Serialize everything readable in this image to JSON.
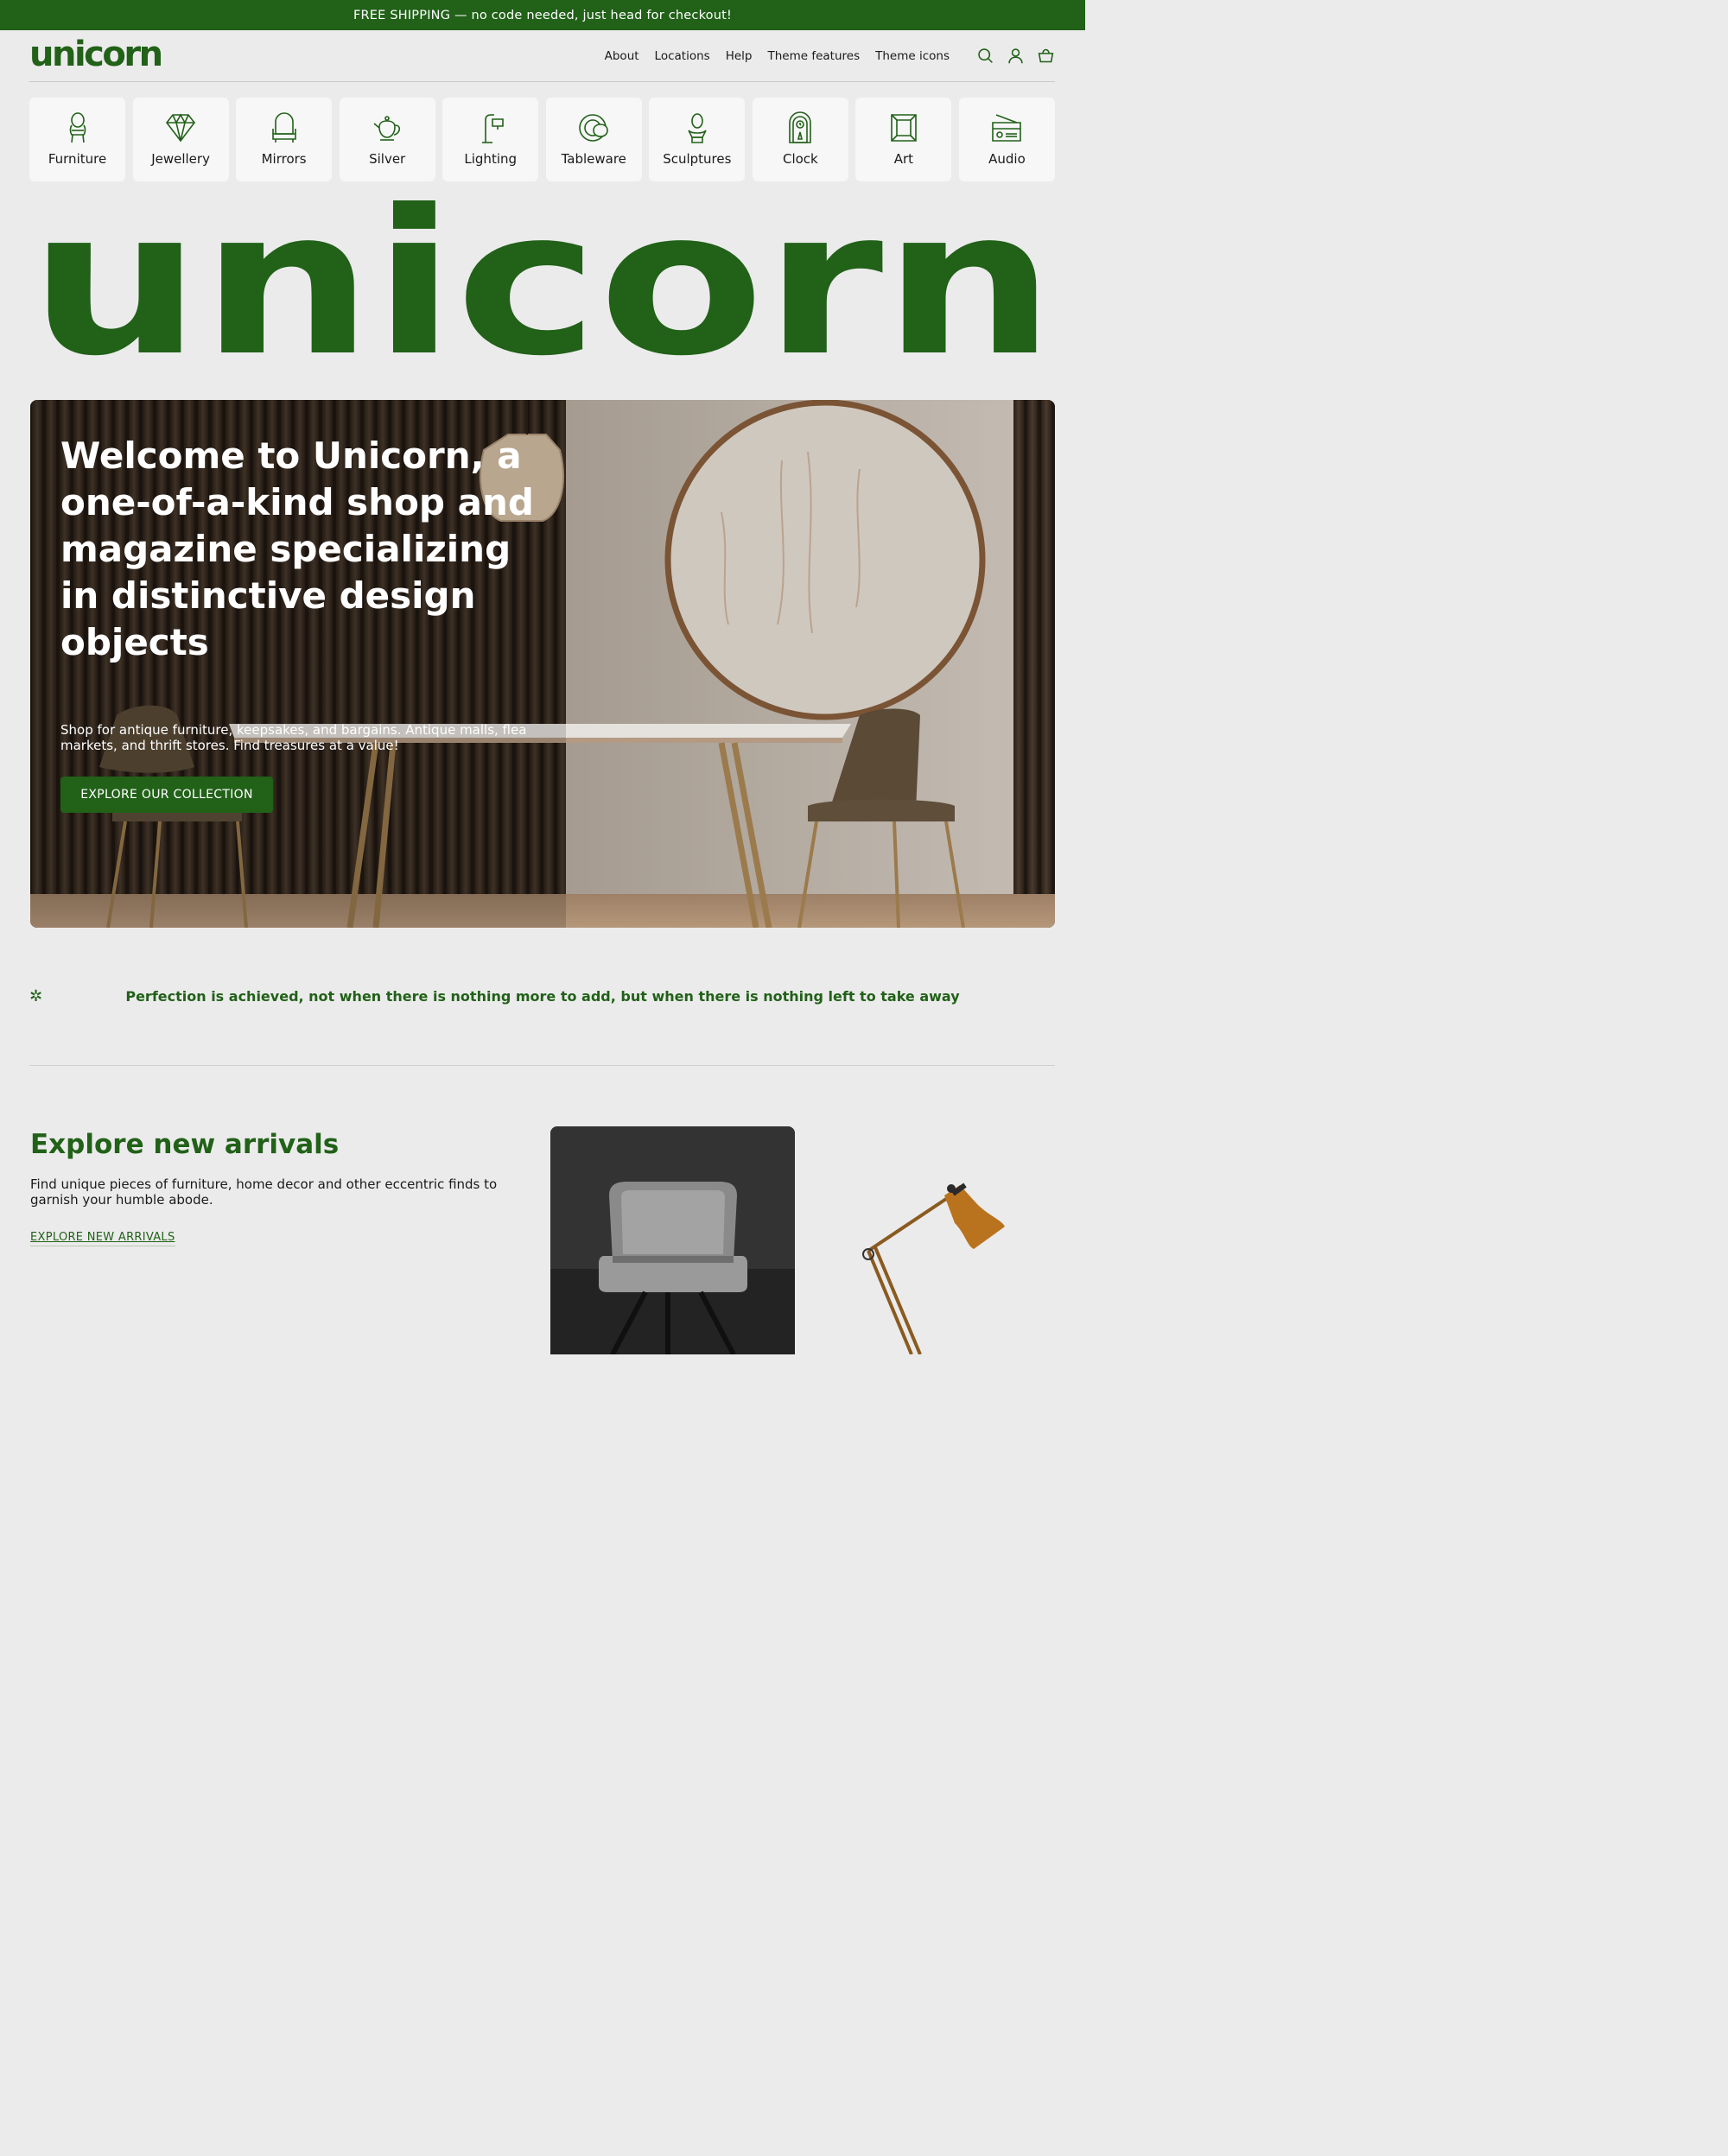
{
  "announcement": "FREE SHIPPING — no code needed, just head for checkout!",
  "header": {
    "logo": "unicorn",
    "nav": [
      "About",
      "Locations",
      "Help",
      "Theme features",
      "Theme icons"
    ],
    "icons": [
      "search-icon",
      "account-icon",
      "cart-icon"
    ]
  },
  "categories": [
    {
      "label": "Furniture",
      "icon": "chair-icon"
    },
    {
      "label": "Jewellery",
      "icon": "diamond-icon"
    },
    {
      "label": "Mirrors",
      "icon": "mirror-icon"
    },
    {
      "label": "Silver",
      "icon": "teapot-icon"
    },
    {
      "label": "Lighting",
      "icon": "lamp-icon"
    },
    {
      "label": "Tableware",
      "icon": "plate-icon"
    },
    {
      "label": "Sculptures",
      "icon": "bust-icon"
    },
    {
      "label": "Clock",
      "icon": "clock-icon"
    },
    {
      "label": "Art",
      "icon": "frame-icon"
    },
    {
      "label": "Audio",
      "icon": "radio-icon"
    }
  ],
  "big_wordmark": "unicorn",
  "hero": {
    "title": "Welcome to Unicorn, a one-of-a-kind shop and magazine specializing in distinctive design objects",
    "subtitle": "Shop for antique furniture, keepsakes, and bargains. Antique malls, flea markets, and thrift stores. Find treasures at a value!",
    "button": "EXPLORE OUR COLLECTION"
  },
  "quote": {
    "icon": "asterisk-icon",
    "text": "Perfection is achieved, not when there is nothing more to add, but when there is nothing left to take away"
  },
  "arrivals": {
    "title": "Explore new arrivals",
    "description": "Find unique pieces of furniture, home decor and other eccentric finds to garnish your humble abode.",
    "link": "EXPLORE NEW ARRIVALS"
  },
  "colors": {
    "brand_green": "#216118",
    "background": "#ebebeb",
    "card": "#f7f7f7"
  }
}
